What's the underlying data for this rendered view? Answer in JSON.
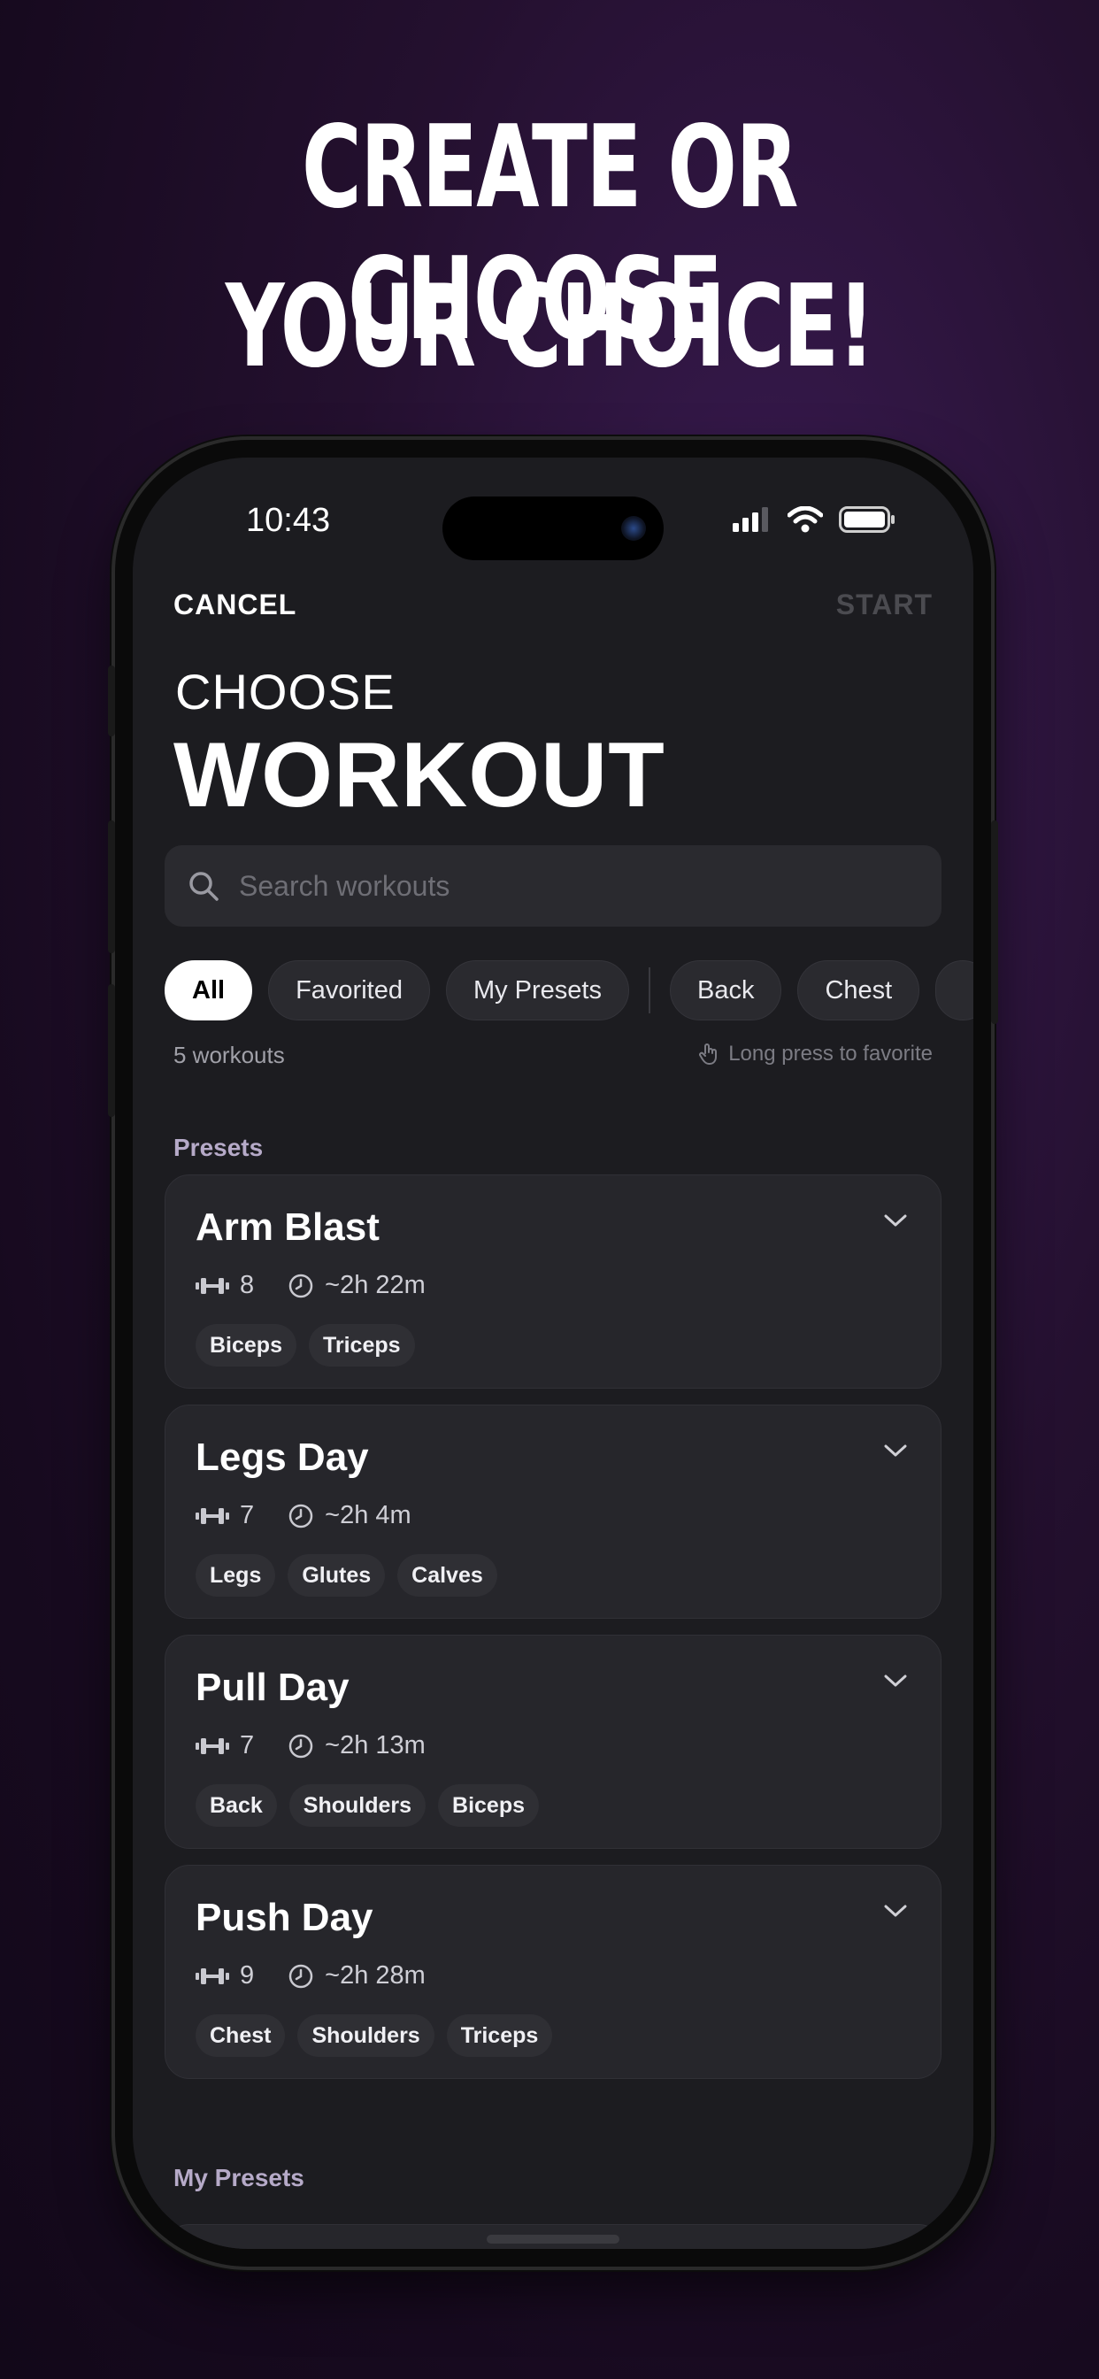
{
  "promo": {
    "line1": "CREATE OR CHOOSE.",
    "line2": "YOUR CHOICE!"
  },
  "status_bar": {
    "time": "10:43",
    "icons": [
      "signal-icon",
      "wifi-icon",
      "battery-icon"
    ]
  },
  "nav": {
    "cancel_label": "CANCEL",
    "start_label": "START"
  },
  "header": {
    "eyebrow": "CHOOSE",
    "title": "WORKOUT"
  },
  "search": {
    "placeholder": "Search workouts",
    "value": ""
  },
  "filters": {
    "chips": [
      "All",
      "Favorited",
      "My Presets",
      "Back",
      "Chest"
    ],
    "selected": "All"
  },
  "summary": {
    "count": "5 workouts",
    "hint": "Long press to favorite"
  },
  "sections": {
    "presets": "Presets",
    "my_presets": "My Presets"
  },
  "workouts": [
    {
      "name": "Arm Blast",
      "exercises": "8",
      "duration": "~2h 22m",
      "tags": [
        "Biceps",
        "Triceps"
      ]
    },
    {
      "name": "Legs Day",
      "exercises": "7",
      "duration": "~2h 4m",
      "tags": [
        "Legs",
        "Glutes",
        "Calves"
      ]
    },
    {
      "name": "Pull Day",
      "exercises": "7",
      "duration": "~2h 13m",
      "tags": [
        "Back",
        "Shoulders",
        "Biceps"
      ]
    },
    {
      "name": "Push Day",
      "exercises": "9",
      "duration": "~2h 28m",
      "tags": [
        "Chest",
        "Shoulders",
        "Triceps"
      ]
    }
  ],
  "colors": {
    "background": "#1c1c20",
    "card": "#26262b",
    "accent_muted": "#b6aac8",
    "start_disabled": "#4b4b50"
  }
}
